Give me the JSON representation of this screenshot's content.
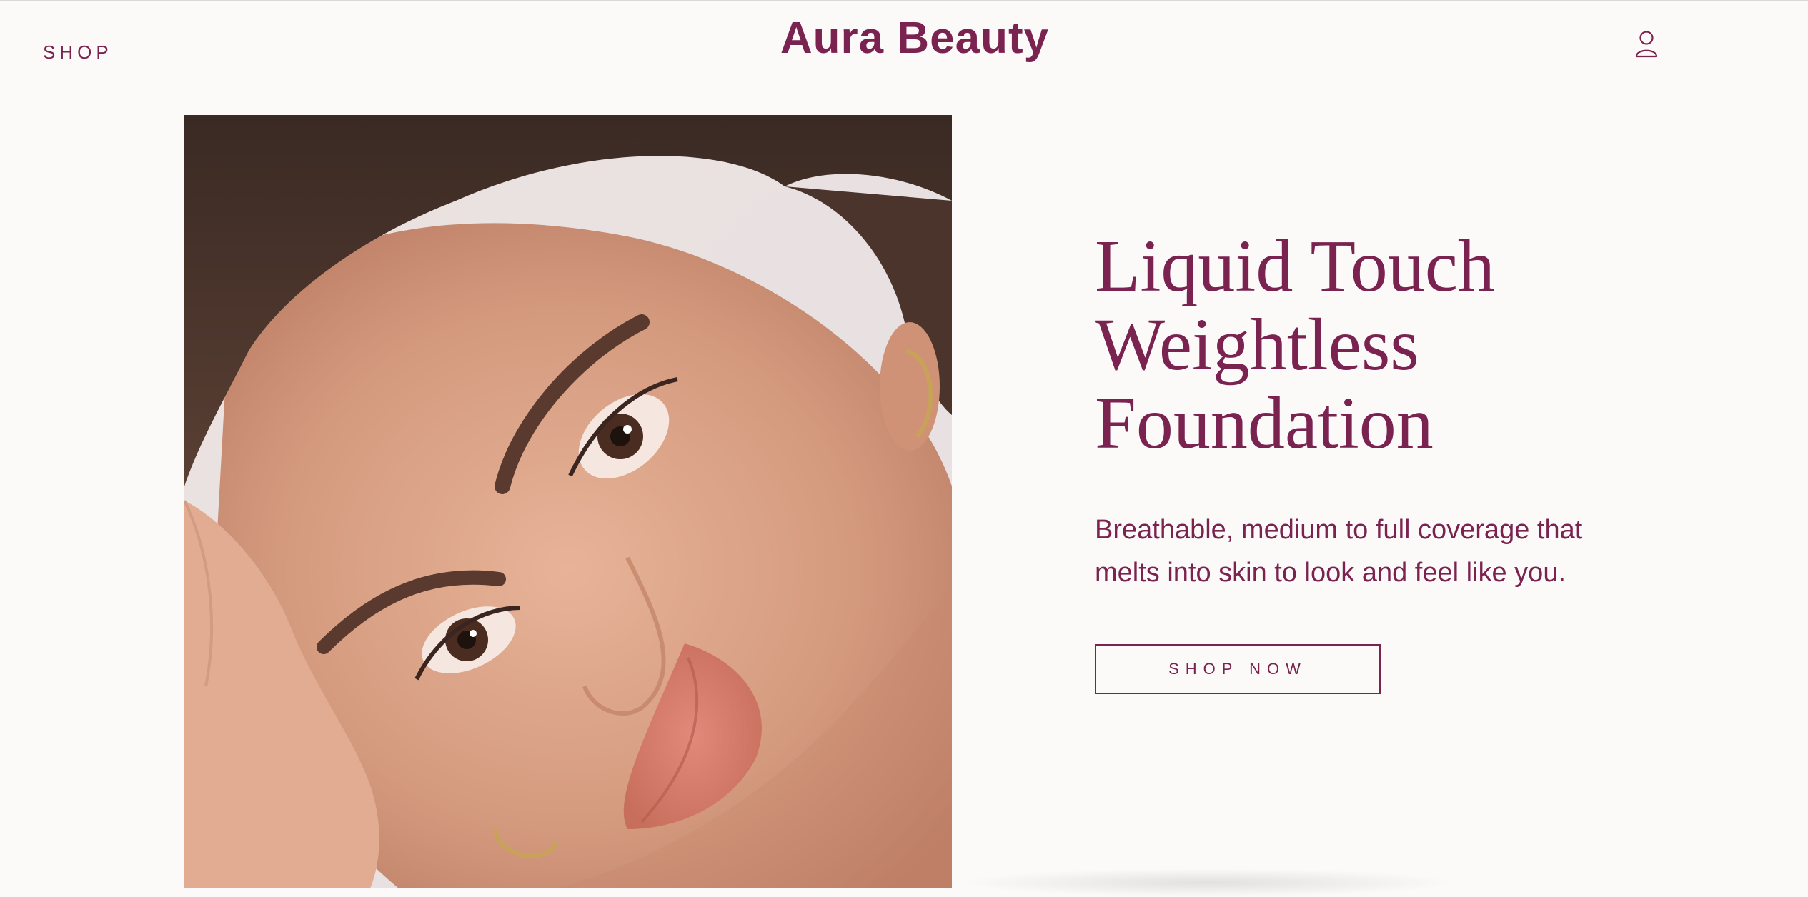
{
  "header": {
    "nav_shop": "SHOP",
    "brand": "Aura Beauty",
    "account_icon": "user-icon"
  },
  "hero": {
    "title_lines": [
      "Liquid Touch",
      "Weightless",
      "Foundation"
    ],
    "description": "Breathable, medium to full coverage that melts into skin to look and feel like you.",
    "cta_label": "SHOP NOW",
    "image_subject": "model-portrait"
  },
  "colors": {
    "background": "#fbfaf8",
    "accent": "#7b2350"
  }
}
